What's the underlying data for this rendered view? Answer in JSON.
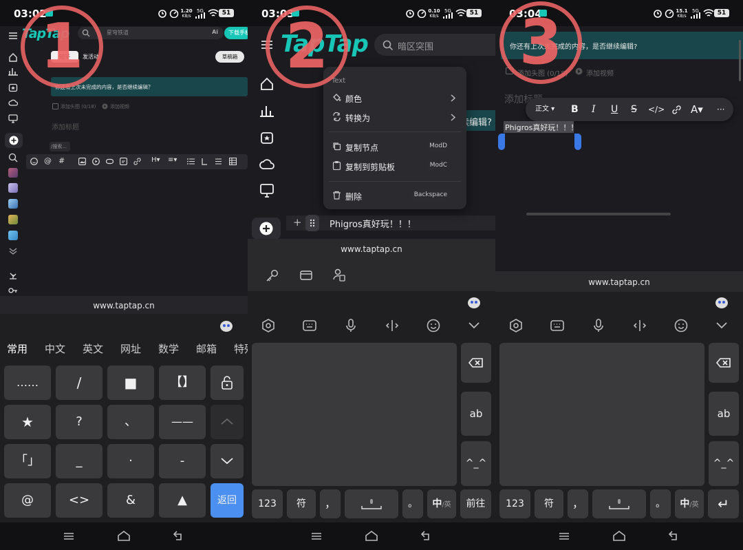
{
  "panel1": {
    "badge": "1",
    "status": {
      "time": "03:02",
      "net_top": "1.20",
      "net_unit": "KB/s",
      "sim": "5G",
      "battery": "51"
    },
    "logo": "TapTap",
    "search_placeholder": "星穹铁道",
    "ai_label": "Ai",
    "download_btn": "下载手机",
    "tab_post": "帖子",
    "tab_event": "发活动",
    "draft_btn": "草稿箱",
    "resume_banner": "你还有上次未完成的内容，是否继续编辑？",
    "add_cover": "添加头图 (0/18)",
    "add_video": "添加视频",
    "title_placeholder": "添加标题",
    "slash_hint": "/搜索...",
    "url": "www.taptap.cn",
    "kb_tabs": [
      "常用",
      "中文",
      "英文",
      "网址",
      "数学",
      "邮箱",
      "特殊"
    ],
    "symbols": [
      "……",
      "/",
      "■",
      "【】",
      "★",
      "?",
      "、",
      "——",
      "「」",
      "_",
      "·",
      "-",
      "@",
      "<>",
      "&",
      "▲"
    ],
    "return_key": "返回"
  },
  "panel2": {
    "badge": "2",
    "status": {
      "time": "03:03",
      "net_top": "0.10",
      "net_unit": "KB/s",
      "sim": "5G",
      "battery": "51"
    },
    "logo": "TapTap",
    "search_placeholder": "暗区突围",
    "menu_header": "Text",
    "menu_color": "颜色",
    "menu_convert": "转换为",
    "menu_copy_node": "复制节点",
    "menu_copy_node_kbd": "ModD",
    "menu_copy_clip": "复制到剪贴板",
    "menu_copy_clip_kbd": "ModC",
    "menu_delete": "删除",
    "menu_delete_kbd": "Backspace",
    "banner_tail": "续编辑?",
    "plus": "+",
    "text_line": "Phigros真好玩！！！",
    "url": "www.taptap.cn",
    "keys": {
      "num": "123",
      "sym": "符",
      "comma": "，",
      "dot": "。",
      "lang": "中",
      "lang_sub": "/英",
      "go": "前往",
      "ab": "ab",
      "face": "^_^"
    }
  },
  "panel3": {
    "badge": "3",
    "status": {
      "time": "03:04",
      "net_top": "15.1",
      "net_unit": "KB/s",
      "sim": "5G",
      "battery": "51"
    },
    "resume_banner": "你还有上次未完成的内容，是否继续编辑?",
    "add_cover": "添加头图 (0/18)",
    "add_video": "添加视频",
    "title_placeholder": "添加标题",
    "style_label": "正文",
    "selected_text": "Phigros真好玩！！！",
    "url": "www.taptap.cn",
    "keys": {
      "num": "123",
      "sym": "符",
      "comma": "，",
      "dot": "。",
      "lang": "中",
      "lang_sub": "/英",
      "ab": "ab",
      "face": "^_^",
      "enter": "↵"
    }
  },
  "colors": {
    "accent": "#18c6b8",
    "badge": "#ee6464",
    "key_blue": "#4b8ff0"
  }
}
